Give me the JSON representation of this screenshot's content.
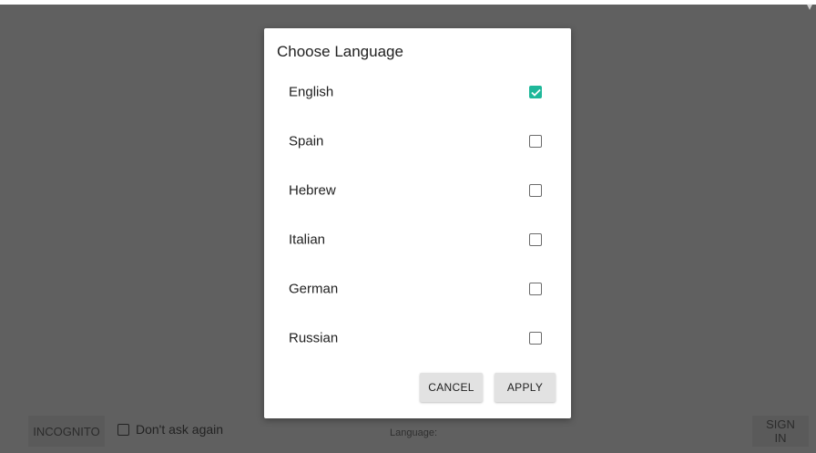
{
  "dialog": {
    "title": "Choose Language",
    "languages": [
      {
        "label": "English",
        "checked": true
      },
      {
        "label": "Spain",
        "checked": false
      },
      {
        "label": "Hebrew",
        "checked": false
      },
      {
        "label": "Italian",
        "checked": false
      },
      {
        "label": "German",
        "checked": false
      },
      {
        "label": "Russian",
        "checked": false
      }
    ],
    "cancel_label": "CANCEL",
    "apply_label": "APPLY"
  },
  "footer": {
    "incognito_label": "INCOGNITO",
    "dont_ask_label": "Don't ask again",
    "dont_ask_checked": false,
    "language_label": "Language:",
    "sign_in_label": "SIGN IN"
  },
  "colors": {
    "accent": "#1fb89a",
    "overlay": "#606060"
  },
  "icons": {
    "status": "wifi-icon",
    "check": "check-icon"
  }
}
